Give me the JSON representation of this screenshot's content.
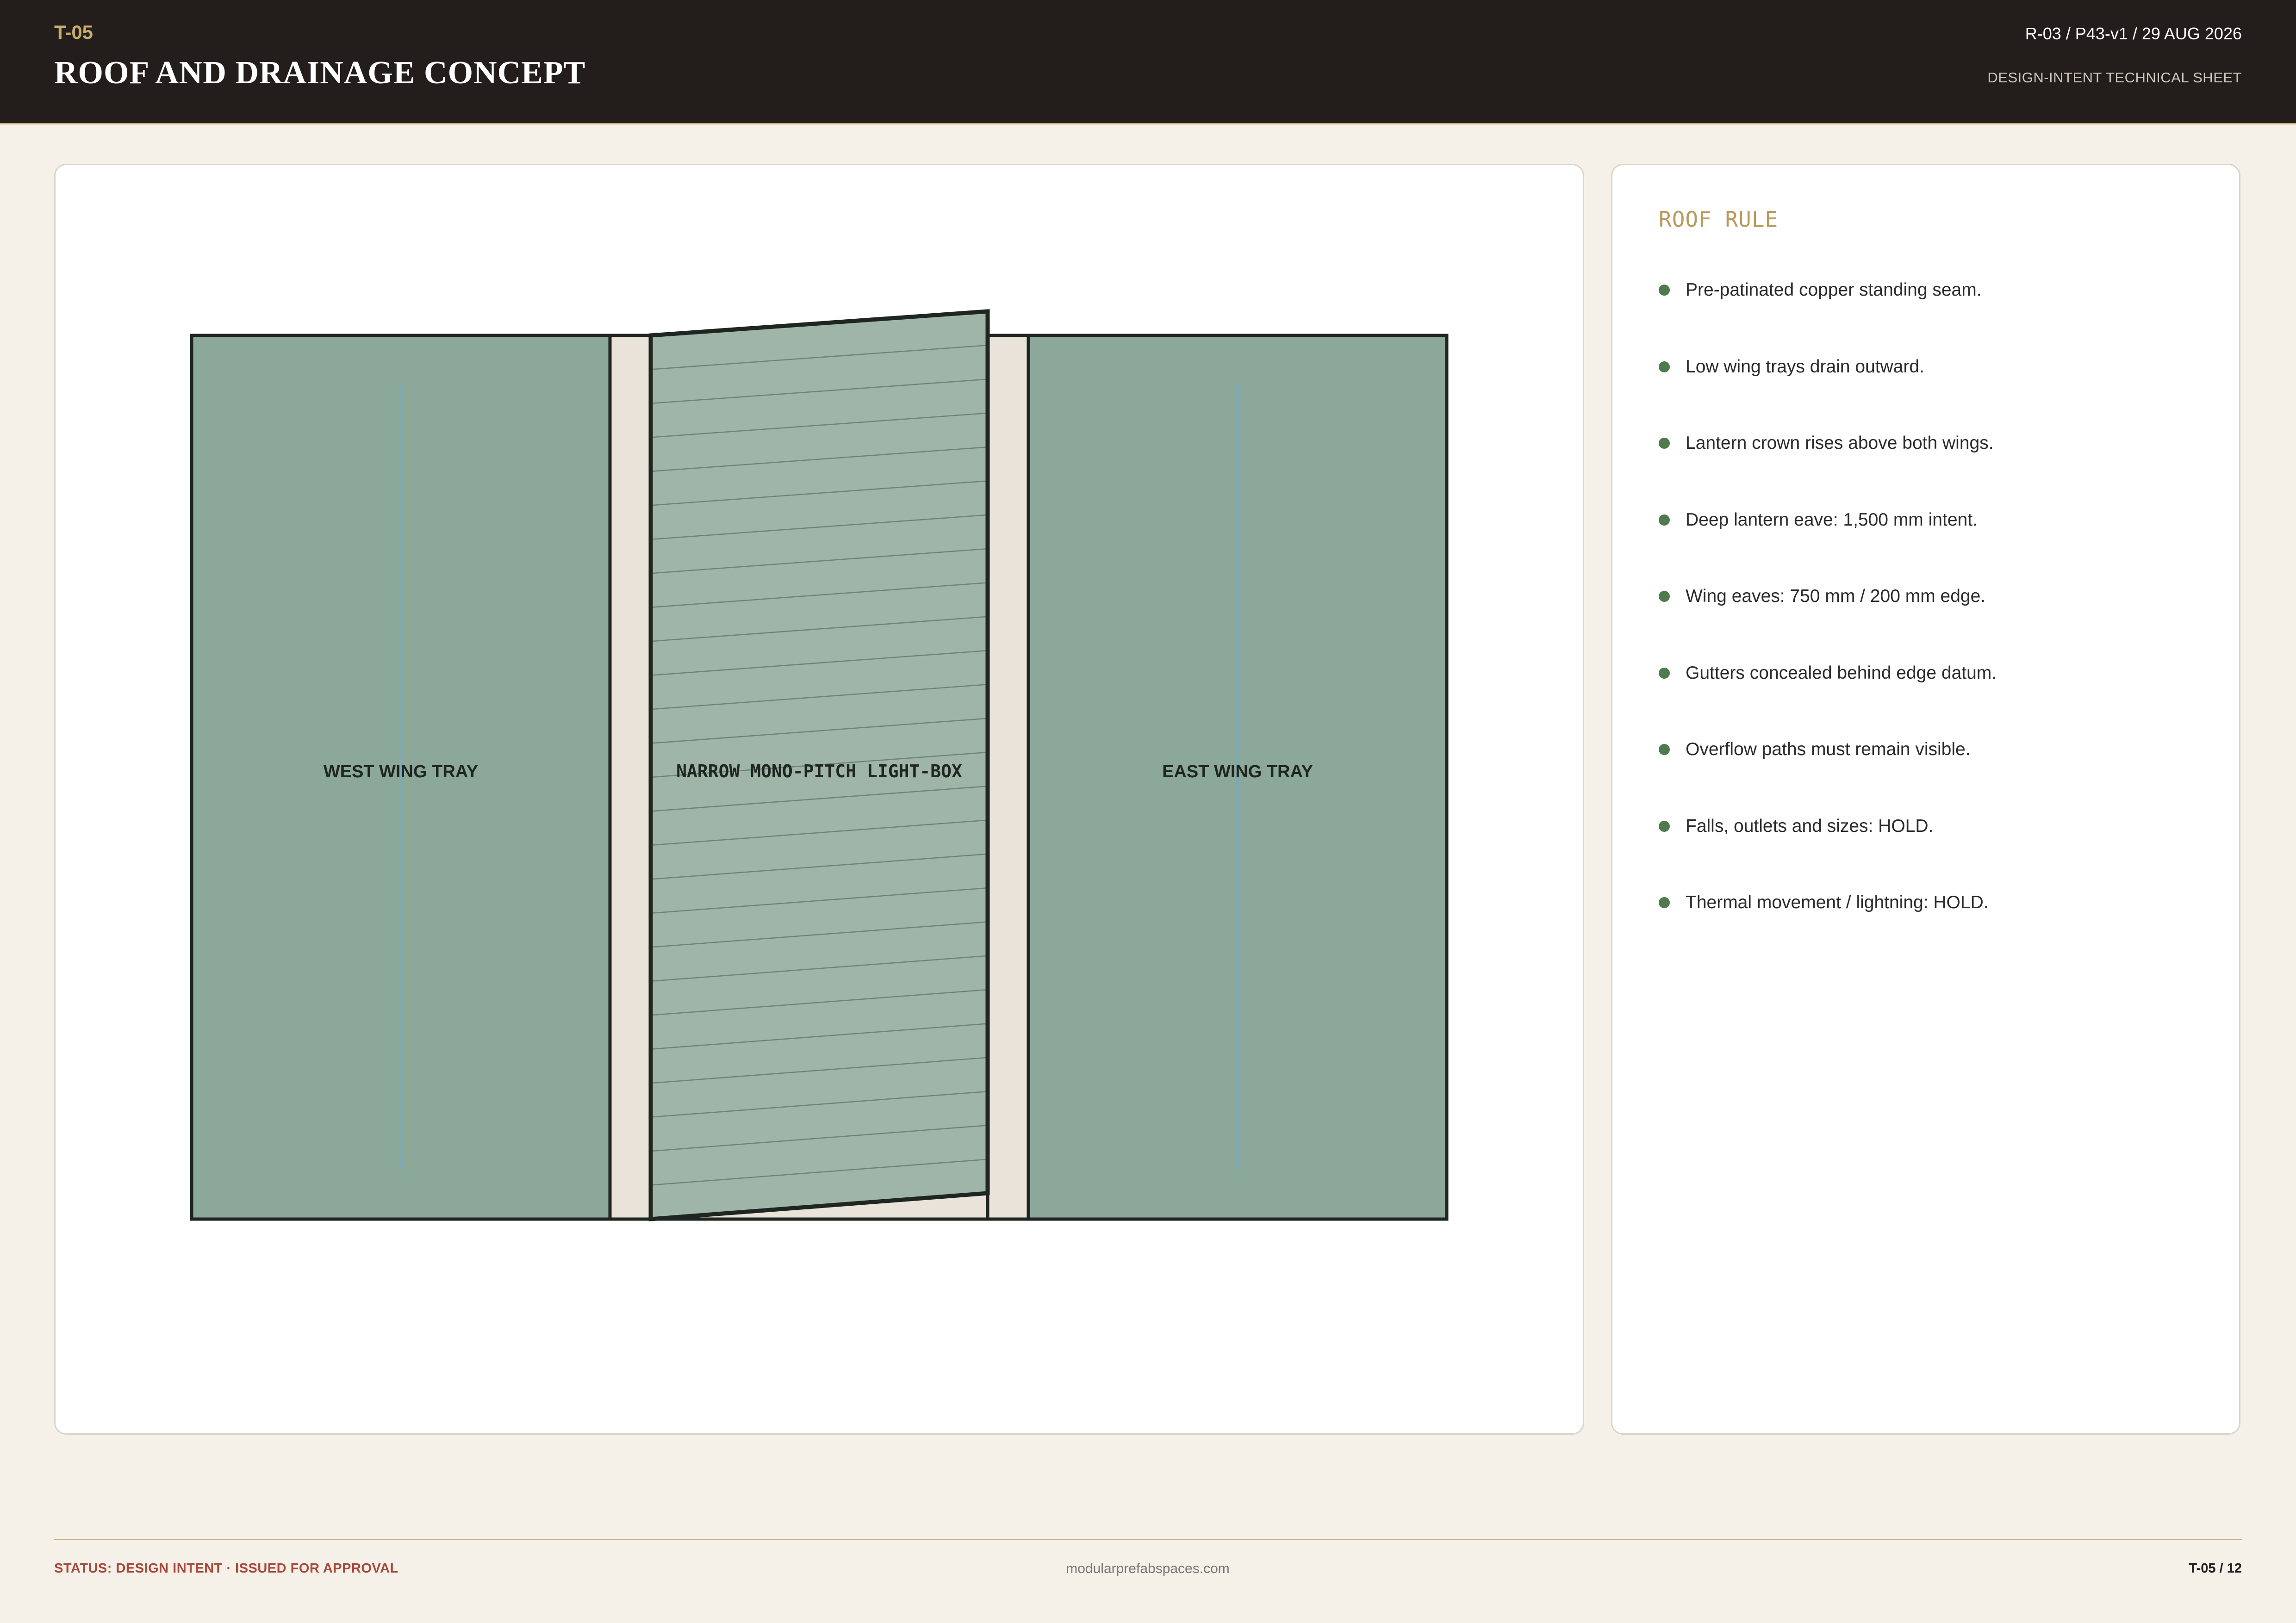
{
  "header": {
    "code": "T-05",
    "title": "ROOF AND DRAINAGE CONCEPT",
    "revision": "R-03 / P43-v1 / 29 AUG 2026",
    "subtitle": "DESIGN-INTENT TECHNICAL SHEET"
  },
  "drawing": {
    "west_label": "WEST WING TRAY",
    "center_label": "NARROW MONO-PITCH LIGHT-BOX",
    "east_label": "EAST WING TRAY",
    "colors": {
      "wing_fill": "#8ca898",
      "lantern_fill": "#9fb5a8",
      "gap_fill": "#e9e3da",
      "outline": "#1f2622",
      "drain_arrow": "#7da9bd"
    }
  },
  "rules": {
    "title": "ROOF RULE",
    "items": [
      "Pre-patinated copper standing seam.",
      "Low wing trays drain outward.",
      "Lantern crown rises above both wings.",
      "Deep lantern eave: 1,500 mm intent.",
      "Wing eaves: 750 mm / 200 mm edge.",
      "Gutters concealed behind edge datum.",
      "Overflow paths must remain visible.",
      "Falls, outlets and sizes: HOLD.",
      "Thermal movement / lightning: HOLD."
    ],
    "bullet_color": "#4f7a50"
  },
  "footer": {
    "status": "STATUS: DESIGN INTENT · ISSUED FOR APPROVAL",
    "site": "modularprefabspaces.com",
    "page": "T-05 / 12"
  }
}
